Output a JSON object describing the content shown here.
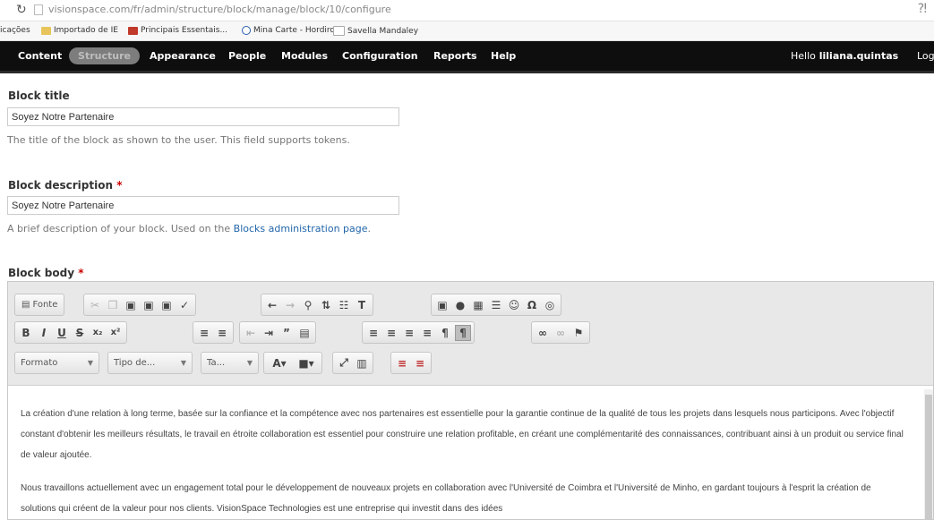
{
  "browser": {
    "url": "visionspace.com/fr/admin/structure/block/manage/block/10/configure",
    "bookmarks": [
      "Importado de IE",
      "Principais Essentais...",
      "Mina Carte - Hordiro...",
      "Savella Mandaley"
    ],
    "bookmarks_prefix": "icações"
  },
  "admin_menu": {
    "items": [
      "Content",
      "Structure",
      "Appearance",
      "People",
      "Modules",
      "Configuration",
      "Reports",
      "Help"
    ],
    "active": "Structure",
    "hello_prefix": "Hello",
    "username": "liliana.quintas",
    "logout": "Log"
  },
  "form": {
    "block_title": {
      "label": "Block title",
      "value": "Soyez Notre Partenaire",
      "description": "The title of the block as shown to the user. This field supports tokens."
    },
    "block_description": {
      "label": "Block description",
      "required_mark": "*",
      "value": "Soyez Notre Partenaire",
      "description_prefix": "A brief description of your block. Used on the",
      "description_link": "Blocks administration page",
      "description_suffix": "."
    },
    "block_body": {
      "label": "Block body",
      "required_mark": "*"
    }
  },
  "editor": {
    "source_label": "Fonte",
    "format_label": "Formato",
    "style_label": "Tipo de...",
    "size_label": "Ta...",
    "paragraphs": [
      "La création d'une relation à long terme, basée sur la confiance et la compétence avec nos partenaires est essentielle pour la garantie continue de la qualité de tous les projets dans lesquels nous participons. Avec l'objectif constant d'obtenir les meilleurs résultats, le travail en étroite collaboration est essentiel pour construire une relation profitable, en créant une complémentarité des connaissances, contribuant ainsi à un produit ou service final de valeur ajoutée.",
      "Nous travaillons actuellement avec un engagement total pour le développement de nouveaux projets en collaboration avec l'Université de Coimbra et l'Université de Minho, en gardant toujours à l'esprit la création de solutions qui créent de la valeur pour nos clients. VisionSpace Technologies est une entreprise qui investit dans des idées"
    ]
  }
}
